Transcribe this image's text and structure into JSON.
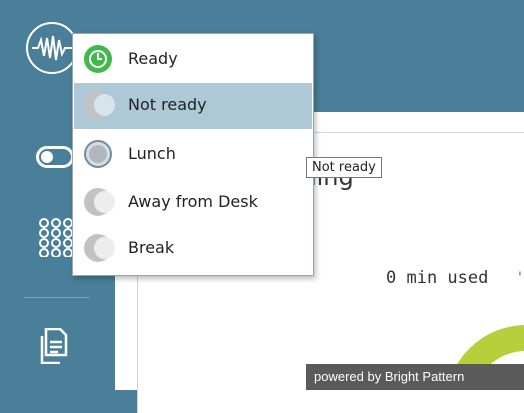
{
  "sidebar": {
    "icons": [
      "waveform-logo-icon",
      "toggle-icon",
      "dialpad-icon",
      "documents-icon"
    ]
  },
  "status_menu": {
    "items": [
      {
        "label": "Ready",
        "icon": "clock-icon",
        "color": "#3fb84c"
      },
      {
        "label": "Not ready",
        "icon": "half-circle-icon",
        "selected": true
      },
      {
        "label": "Lunch",
        "icon": "ring-circle-icon"
      },
      {
        "label": "Away from Desk",
        "icon": "half-circle-icon"
      },
      {
        "label": "Break",
        "icon": "half-circle-icon"
      }
    ]
  },
  "tooltip": {
    "text": "Not ready"
  },
  "main": {
    "title_partial": "aining",
    "usage_text": "0 min used",
    "usage_tick": "'"
  },
  "footer": {
    "powered_text": "powered by Bright Pattern"
  },
  "colors": {
    "sidebar": "#4a7f99",
    "selected": "#adc8d7",
    "ready": "#3fb84c",
    "chart": "#b7cf3a"
  }
}
